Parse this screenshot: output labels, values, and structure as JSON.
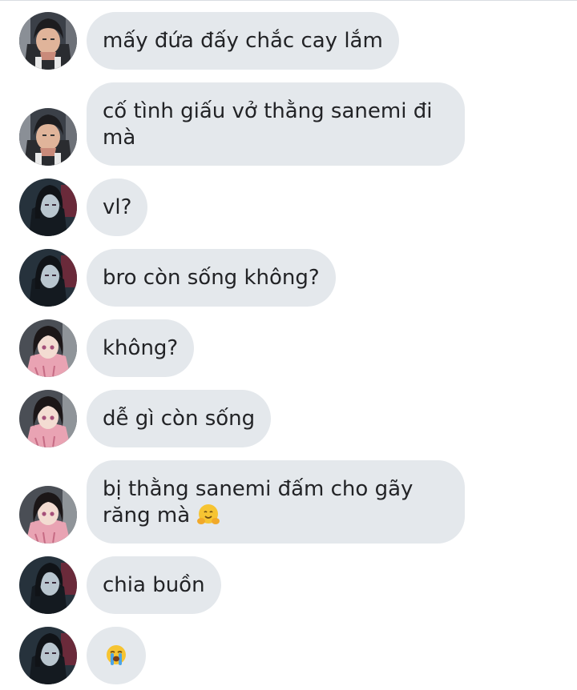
{
  "messages": [
    {
      "avatar": "avatar-dark-hair-man",
      "text": "mấy đứa đấy chắc cay lắm",
      "emoji": ""
    },
    {
      "avatar": "avatar-dark-hair-man",
      "text": "cố tình giấu vở thằng sanemi đi mà",
      "emoji": ""
    },
    {
      "avatar": "avatar-long-hair-dark",
      "text": "vl?",
      "emoji": ""
    },
    {
      "avatar": "avatar-long-hair-dark",
      "text": "bro còn sống không?",
      "emoji": ""
    },
    {
      "avatar": "avatar-pink-kimono-girl",
      "text": "không?",
      "emoji": ""
    },
    {
      "avatar": "avatar-pink-kimono-girl",
      "text": "dễ gì còn sống",
      "emoji": ""
    },
    {
      "avatar": "avatar-pink-kimono-girl",
      "text": "bị thằng sanemi đấm cho gãy răng mà ",
      "emoji": "hugging-face-emoji"
    },
    {
      "avatar": "avatar-long-hair-dark",
      "text": "chia buồn",
      "emoji": ""
    },
    {
      "avatar": "avatar-long-hair-dark",
      "text": "",
      "emoji": "loudly-crying-face-emoji"
    }
  ],
  "colors": {
    "bubble_bg": "#e4e8ec",
    "text": "#222326",
    "divider": "#d9dde2"
  }
}
